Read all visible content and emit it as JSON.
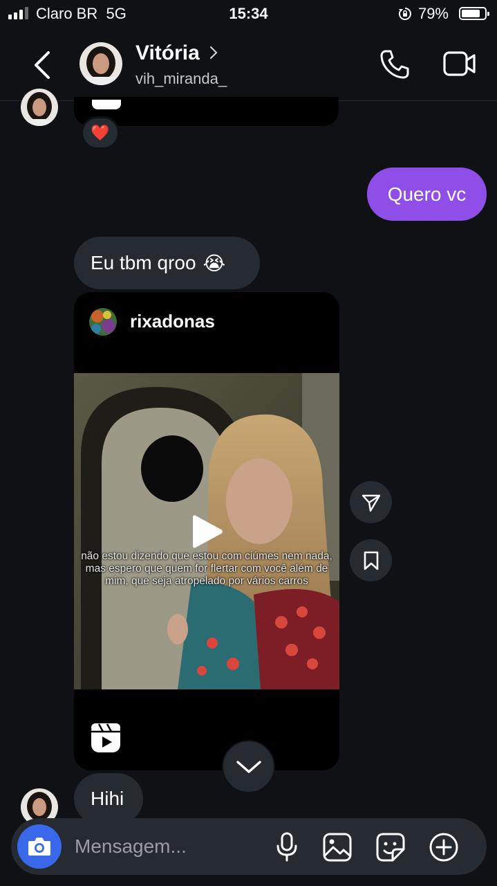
{
  "status_bar": {
    "carrier": "Claro BR",
    "network": "5G",
    "time": "15:34",
    "battery": "79%"
  },
  "header": {
    "name": "Vitória",
    "username": "vih_miranda_"
  },
  "messages": {
    "reaction": "❤️",
    "outgoing_1": "Quero vc",
    "incoming_1": "Eu tbm qroo",
    "incoming_1_emoji": "😭",
    "incoming_2": "Hihi"
  },
  "shared_post": {
    "username": "rixadonas",
    "caption": "não estou dizendo que estou com ciúmes nem nada, mas espero que quem for flertar com você além de mim, que seja atropelado por vários carros"
  },
  "composer": {
    "placeholder": "Mensagem..."
  },
  "colors": {
    "background": "#0f1115",
    "bubble_incoming": "#262a31",
    "bubble_outgoing": "#8f4ee8",
    "camera_button": "#3a68ea"
  }
}
